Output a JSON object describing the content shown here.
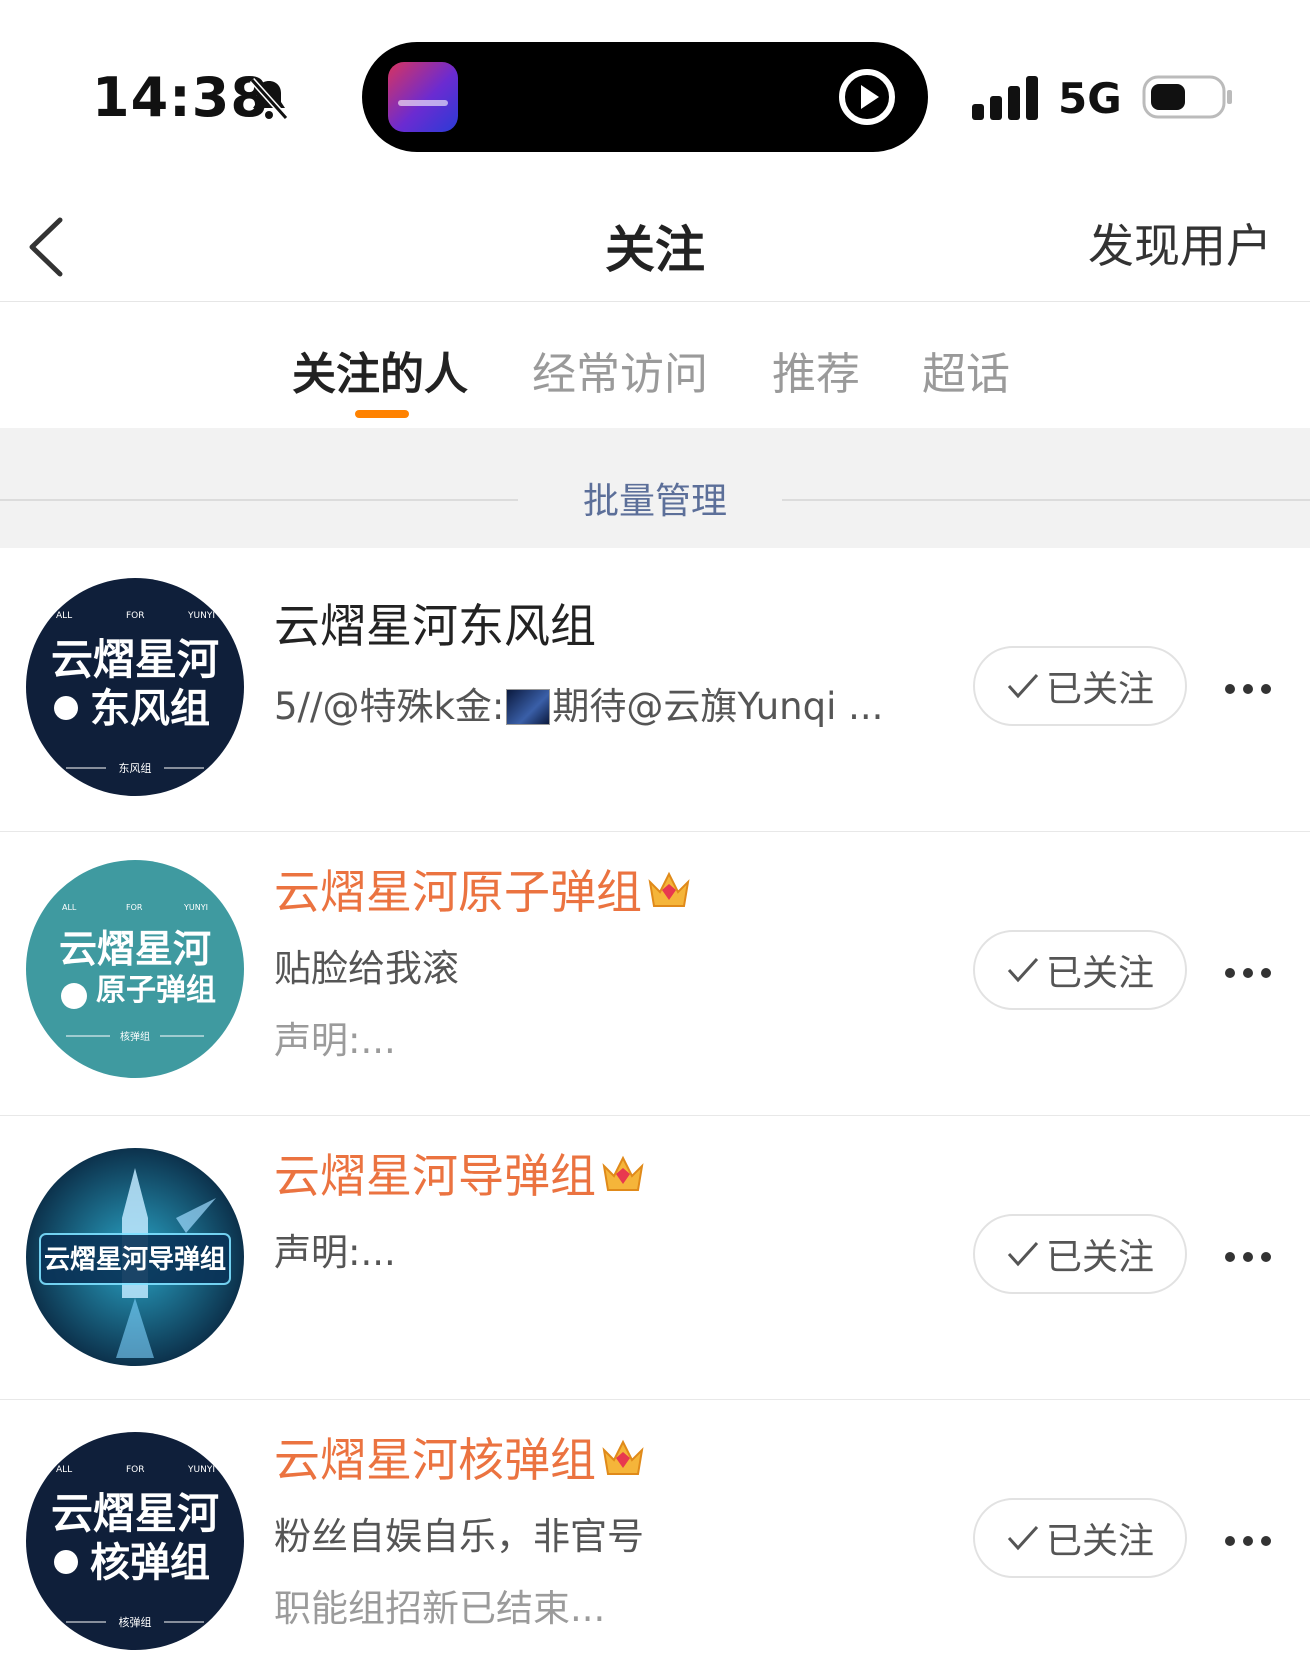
{
  "status": {
    "time": "14:38",
    "network": "5G"
  },
  "nav": {
    "title": "关注",
    "right": "发现用户"
  },
  "tabs": [
    {
      "label": "关注的人",
      "active": true
    },
    {
      "label": "经常访问",
      "active": false
    },
    {
      "label": "推荐",
      "active": false
    },
    {
      "label": "超话",
      "active": false
    }
  ],
  "batch": {
    "label": "批量管理"
  },
  "colors": {
    "accent": "#ff8200",
    "vip_name": "#eb7340"
  },
  "follow_label": "已关注",
  "users": [
    {
      "name": "云熠星河东风组",
      "vip": false,
      "desc_prefix": "5//@特殊k金:",
      "desc_suffix": "期待@云旗Yunqi ...",
      "desc2": "",
      "avatar_lines": [
        "云熠星河",
        "东风组"
      ],
      "avatar_small_top": [
        "ALL",
        "FOR",
        "YUNYI"
      ],
      "avatar_footer": "东风组",
      "avatar_bg": "#0f1f3a"
    },
    {
      "name": "云熠星河原子弹组",
      "vip": true,
      "desc": "贴脸给我滚",
      "desc2": "声明:...",
      "avatar_lines": [
        "云熠星河",
        "原子弹组"
      ],
      "avatar_small_top": [
        "ALL",
        "FOR",
        "YUNYI"
      ],
      "avatar_footer": "核弹组",
      "avatar_bg": "#3f9aa0"
    },
    {
      "name": "云熠星河导弹组",
      "vip": true,
      "desc": "声明:...",
      "desc2": "",
      "avatar_lines": [
        "云熠星河导弹组"
      ],
      "avatar_bg": "#0c2a4a"
    },
    {
      "name": "云熠星河核弹组",
      "vip": true,
      "desc": "粉丝自娱自乐，非官号",
      "desc2": "职能组招新已结束...",
      "avatar_lines": [
        "云熠星河",
        "核弹组"
      ],
      "avatar_small_top": [
        "ALL",
        "FOR",
        "YUNYI"
      ],
      "avatar_footer": "核弹组",
      "avatar_bg": "#0f1f3a"
    }
  ]
}
